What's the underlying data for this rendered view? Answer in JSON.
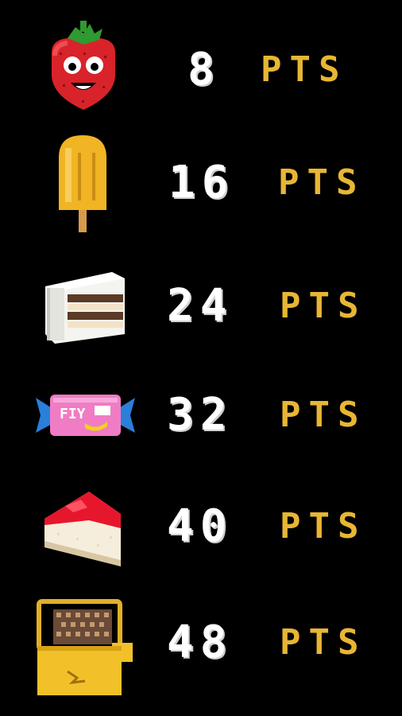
{
  "score_table": {
    "unit_label": "PTS",
    "items": [
      {
        "icon": "strawberry-icon",
        "points": "8"
      },
      {
        "icon": "popsicle-icon",
        "points": "16"
      },
      {
        "icon": "cake-slice-icon",
        "points": "24"
      },
      {
        "icon": "candy-icon",
        "points": "32"
      },
      {
        "icon": "cheesecake-icon",
        "points": "40"
      },
      {
        "icon": "radio-icon",
        "points": "48"
      }
    ]
  },
  "colors": {
    "background": "#000000",
    "points_text": "#ffffff",
    "unit_text": "#e8b634"
  }
}
